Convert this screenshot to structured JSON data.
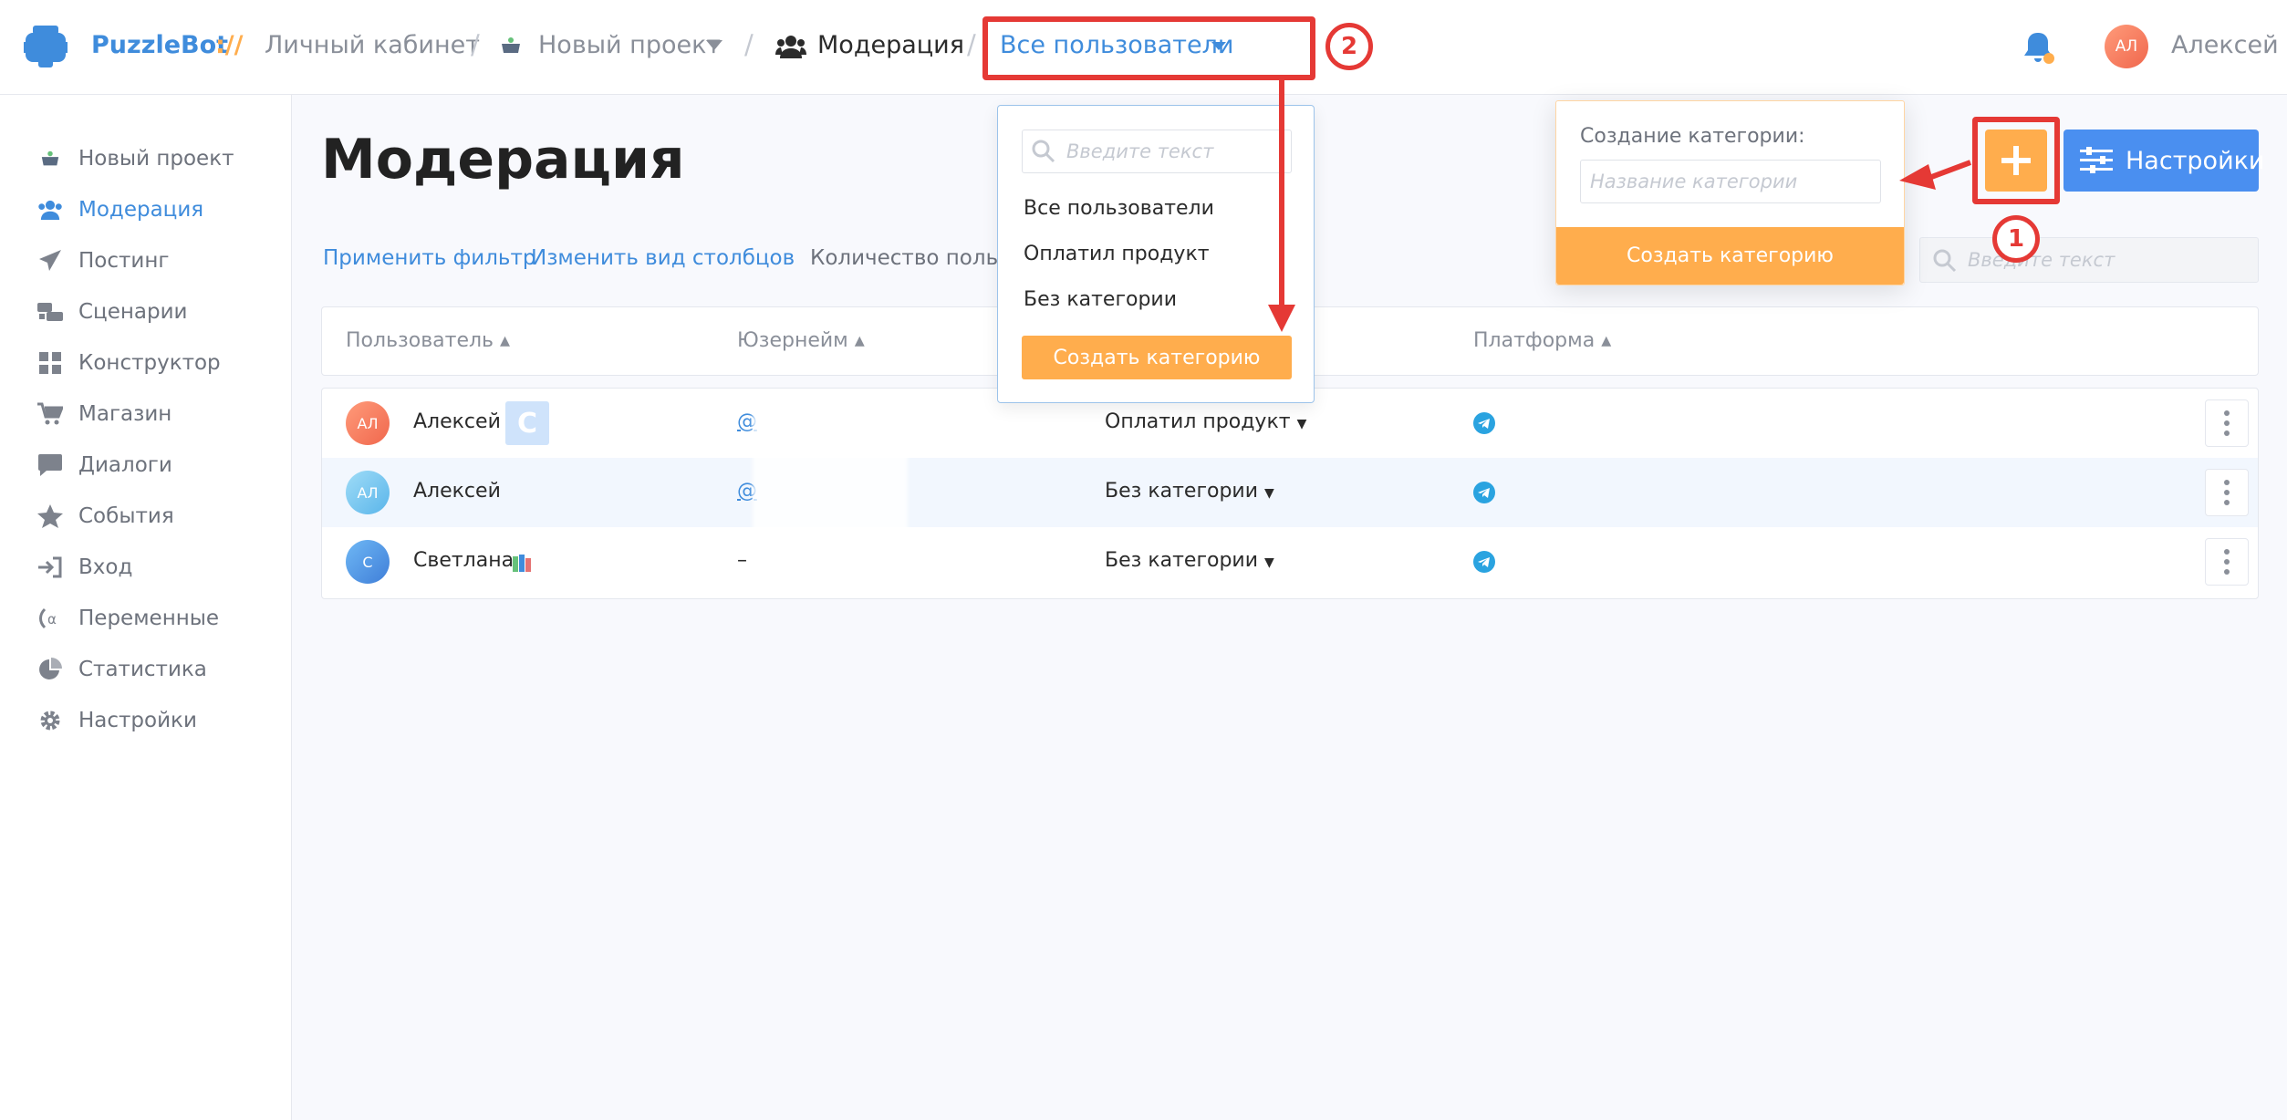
{
  "brand": {
    "name": "PuzzleBot",
    "separator": "://"
  },
  "breadcrumb": {
    "cabinet": "Личный кабинет",
    "project": "Новый проект",
    "moderation": "Модерация",
    "filter": "Все пользователи"
  },
  "user": {
    "initials": "АЛ",
    "name": "Алексей"
  },
  "sidebar": {
    "items": [
      {
        "label": "Новый проект",
        "icon": "pot-icon"
      },
      {
        "label": "Модерация",
        "icon": "users-icon"
      },
      {
        "label": "Постинг",
        "icon": "paper-plane-icon"
      },
      {
        "label": "Сценарии",
        "icon": "scenarios-icon"
      },
      {
        "label": "Конструктор",
        "icon": "grid-icon"
      },
      {
        "label": "Магазин",
        "icon": "cart-icon"
      },
      {
        "label": "Диалоги",
        "icon": "chat-icon"
      },
      {
        "label": "События",
        "icon": "star-icon"
      },
      {
        "label": "Вход",
        "icon": "sign-in-icon"
      },
      {
        "label": "Переменные",
        "icon": "variable-icon"
      },
      {
        "label": "Статистика",
        "icon": "pie-chart-icon"
      },
      {
        "label": "Настройки",
        "icon": "gear-icon"
      }
    ]
  },
  "main": {
    "title": "Модерация",
    "apply_filter": "Применить фильтр",
    "change_columns": "Изменить вид столбцов",
    "users_count": "Количество пользо",
    "search_placeholder": "Введите текст",
    "settings_label": "Настройки"
  },
  "table": {
    "headers": {
      "user": "Пользователь",
      "username": "Юзернейм",
      "platform": "Платформа"
    },
    "rows": [
      {
        "initials": "АЛ",
        "name": "Алексей",
        "badge": "C",
        "username": "@",
        "category": "Оплатил продукт"
      },
      {
        "initials": "АЛ",
        "name": "Алексей",
        "badge": "",
        "username": "@",
        "category": "Без категории"
      },
      {
        "initials": "С",
        "name": "Светлана",
        "badge": "",
        "username": "–",
        "category": "Без категории"
      }
    ]
  },
  "dropdown": {
    "search_placeholder": "Введите текст",
    "options": [
      "Все пользователи",
      "Оплатил продукт",
      "Без категории"
    ],
    "create_button": "Создать категорию"
  },
  "category_popover": {
    "label": "Создание категории:",
    "placeholder": "Название категории",
    "button": "Создать категорию"
  },
  "annotations": {
    "one": "1",
    "two": "2"
  },
  "colors": {
    "accent": "#3f8cdc",
    "orange": "#ffad4d",
    "annotation_red": "#e53935",
    "settings_blue": "#4a8ff0"
  }
}
